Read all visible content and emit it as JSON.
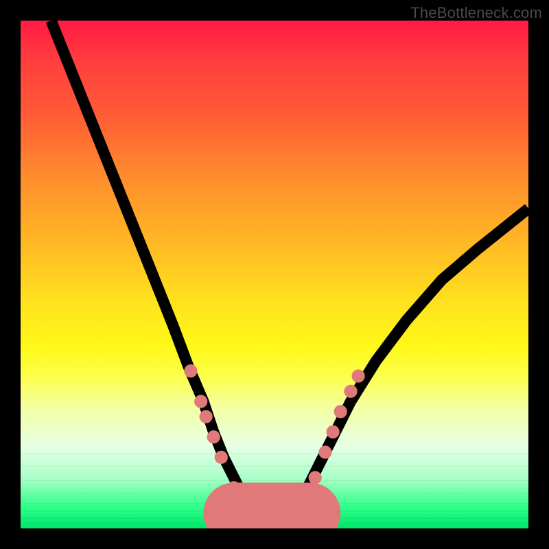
{
  "watermark": "TheBottleneck.com",
  "chart_data": {
    "type": "line",
    "title": "",
    "xlabel": "",
    "ylabel": "",
    "xlim": [
      0,
      100
    ],
    "ylim": [
      0,
      100
    ],
    "x": [
      6,
      10,
      14,
      18,
      22,
      26,
      30,
      33,
      36,
      38,
      40,
      42,
      44,
      46,
      48,
      50,
      52,
      54,
      56,
      58,
      61,
      65,
      70,
      76,
      83,
      90,
      100
    ],
    "y": [
      100,
      90,
      80,
      70,
      60,
      50,
      40,
      32,
      25,
      19,
      14,
      10,
      6,
      4,
      3,
      3,
      3,
      4,
      7,
      11,
      17,
      25,
      33,
      41,
      49,
      55,
      63
    ],
    "trough_x_range": [
      42,
      57
    ],
    "trough_y": 3,
    "left_dots": [
      {
        "x": 33.5,
        "y": 31
      },
      {
        "x": 35.5,
        "y": 25
      },
      {
        "x": 36.5,
        "y": 22
      },
      {
        "x": 38,
        "y": 18
      },
      {
        "x": 39.5,
        "y": 14
      },
      {
        "x": 42,
        "y": 8
      }
    ],
    "right_dots": [
      {
        "x": 58,
        "y": 10
      },
      {
        "x": 60,
        "y": 15
      },
      {
        "x": 61.5,
        "y": 19
      },
      {
        "x": 63,
        "y": 23
      },
      {
        "x": 65,
        "y": 27
      },
      {
        "x": 66.5,
        "y": 30
      }
    ],
    "colors": {
      "curve": "#000000",
      "accent": "#e07a7a",
      "gradient_top": "#ff1a46",
      "gradient_bottom": "#00e66a"
    }
  }
}
